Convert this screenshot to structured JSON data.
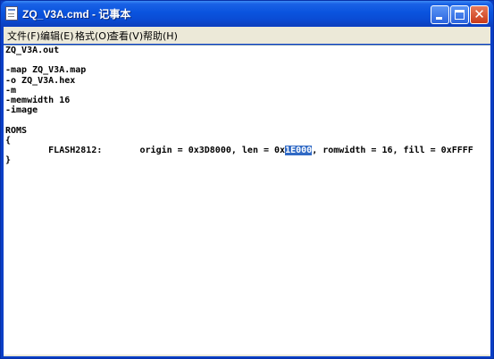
{
  "window": {
    "title": "ZQ_V3A.cmd - 记事本",
    "close_glyph": "✕"
  },
  "menu": {
    "items": [
      {
        "label": "文件(F)"
      },
      {
        "label": "编辑(E)"
      },
      {
        "label": "格式(O)"
      },
      {
        "label": "查看(V)"
      },
      {
        "label": "帮助(H)"
      }
    ]
  },
  "document": {
    "lines": [
      "ZQ_V3A.out",
      "",
      "-map ZQ_V3A.map",
      "-o ZQ_V3A.hex",
      "-m",
      "-memwidth 16",
      "-image",
      "",
      "ROMS",
      "{",
      "        FLASH2812:       origin = 0x3D8000, len = 0x",
      "}"
    ],
    "flash_line": {
      "prefix": "        FLASH2812:       origin = 0x3D8000, len = 0x",
      "selected": "1E000",
      "suffix": ", romwidth = 16, fill = 0xFFFF"
    }
  }
}
